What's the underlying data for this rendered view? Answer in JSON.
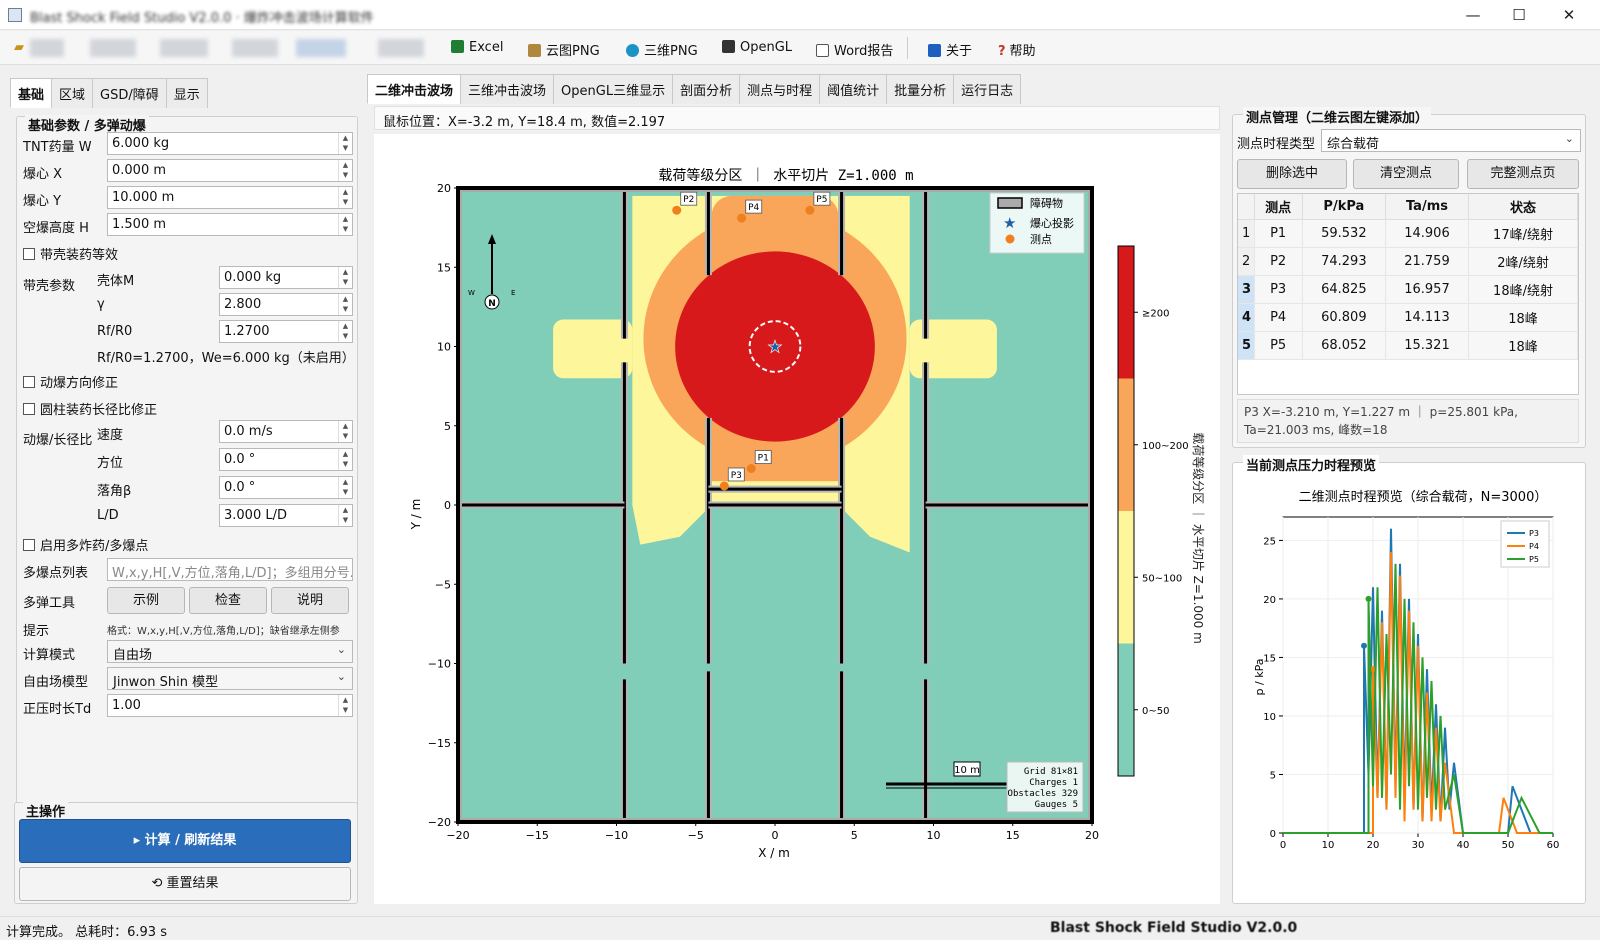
{
  "window": {
    "title": "Blast Shock Field Studio V2.0.0 · 爆炸冲击波场计算软件",
    "min": "—",
    "max": "☐",
    "close": "✕"
  },
  "menubar": [
    {
      "label": "Excel",
      "icon": "excel-icon",
      "color": "#1e7e34"
    },
    {
      "label": "云图PNG",
      "icon": "image-icon",
      "color": "#8a6d3b"
    },
    {
      "label": "三维PNG",
      "icon": "globe-icon",
      "color": "#1a94c4"
    },
    {
      "label": "OpenGL",
      "icon": "opengl-icon",
      "color": "#333333"
    },
    {
      "label": "Word报告",
      "icon": "document-icon",
      "color": "#555555"
    },
    {
      "label": "关于",
      "icon": "info-icon",
      "color": "#1f5fbf"
    },
    {
      "label": "帮助",
      "icon": "help-icon",
      "color": "#c0392b"
    }
  ],
  "left": {
    "tabs": [
      "基础",
      "区域",
      "GSD/障碍",
      "显示"
    ],
    "group_title": "基础参数 / 多弹动爆",
    "tnt": {
      "label": "TNT药量 W",
      "value": "6.000 kg"
    },
    "cx": {
      "label": "爆心 X",
      "value": "0.000 m"
    },
    "cy": {
      "label": "爆心 Y",
      "value": "10.000 m"
    },
    "h": {
      "label": "空爆高度 H",
      "value": "1.500 m"
    },
    "shell_check": "带壳装药等效",
    "shell_label": "带壳参数",
    "shell_mass": {
      "label": "壳体M",
      "value": "0.000 kg"
    },
    "gamma": {
      "label": "γ",
      "value": "2.800"
    },
    "rf": {
      "label": "Rf/R0",
      "value": "1.2700"
    },
    "rf_note": "Rf/R0=1.2700，We=6.000 kg（未启用）",
    "dyn_check": "动爆方向修正",
    "cyl_check": "圆柱装药长径比修正",
    "dyn_label": "动爆/长径比",
    "speed": {
      "label": "速度",
      "value": "0.0 m/s"
    },
    "azimuth": {
      "label": "方位",
      "value": "0.0 °"
    },
    "fall": {
      "label": "落角β",
      "value": "0.0 °"
    },
    "ld": {
      "label": "L/D",
      "value": "3.000 L/D"
    },
    "multi_check": "启用多炸药/多爆点",
    "multi_list": {
      "label": "多爆点列表",
      "placeholder": "W,x,y,H[,V,方位,落角,L/D]；多组用分号..."
    },
    "tools": {
      "label": "多弹工具",
      "buttons": [
        "示例",
        "检查",
        "说明"
      ]
    },
    "hint": {
      "label": "提示",
      "text": "格式：W,x,y,H[,V,方位,落角,L/D]；缺省继承左侧参"
    },
    "mode": {
      "label": "计算模式",
      "value": "自由场"
    },
    "model": {
      "label": "自由场模型",
      "value": "Jinwon Shin 模型"
    },
    "td": {
      "label": "正压时长Td",
      "value": "1.00"
    },
    "main_title": "主操作",
    "compute": "▸  计算 / 刷新结果",
    "reset": "重置结果"
  },
  "center": {
    "tabs": [
      "二维冲击波场",
      "三维冲击波场",
      "OpenGL三维显示",
      "剖面分析",
      "测点与时程",
      "阈值统计",
      "批量分析",
      "运行日志"
    ],
    "mouse": "鼠标位置：X=-3.2 m, Y=18.4 m, 数值=2.197"
  },
  "heatmap": {
    "type": "heatmap",
    "title": "载荷等级分区  ｜  水平切片 Z=1.000 m",
    "xlabel": "X / m",
    "ylabel": "Y / m",
    "xlim": [
      -20,
      20
    ],
    "ylim": [
      -20,
      20
    ],
    "xticks": [
      "−20",
      "−15",
      "−10",
      "−5",
      "0",
      "5",
      "10",
      "15",
      "20"
    ],
    "yticks": [
      "20",
      "15",
      "10",
      "5",
      "0",
      "−5",
      "−10",
      "−15",
      "−20"
    ],
    "colorbar": [
      "≥200",
      "100~200",
      "50~100",
      "0~50"
    ],
    "colorbar_title": "载荷等级分区  ｜  水平切片 Z=1.000 m",
    "colors": {
      "c200": "#d7191c",
      "c100": "#f9a65a",
      "c50": "#fdf69b",
      "c0": "#80cdb8"
    },
    "charge": {
      "x": 0,
      "y": 10
    },
    "legend": [
      "障碍物",
      "爆心投影",
      "测点"
    ],
    "north": {
      "n": "N",
      "w": "W",
      "e": "E"
    },
    "scalebar": "10 m",
    "info": [
      "Grid 81×81",
      "Charges 1",
      "Obstacles 329",
      "Gauges 5"
    ],
    "gauges": [
      {
        "name": "P1",
        "x": -1.5,
        "y": 2.3
      },
      {
        "name": "P2",
        "x": -6.2,
        "y": 18.6
      },
      {
        "name": "P3",
        "x": -3.2,
        "y": 1.2
      },
      {
        "name": "P4",
        "x": -2.1,
        "y": 18.1
      },
      {
        "name": "P5",
        "x": 2.2,
        "y": 18.6
      }
    ]
  },
  "right": {
    "title": "测点管理（二维云图左键添加）",
    "type": {
      "label": "测点时程类型",
      "value": "综合载荷"
    },
    "buttons": [
      "删除选中",
      "清空测点",
      "完整测点页"
    ],
    "columns": [
      "测点",
      "P/kPa",
      "Ta/ms",
      "状态"
    ],
    "rows": [
      {
        "n": "1",
        "name": "P1",
        "p": "59.532",
        "ta": "14.906",
        "status": "17峰/绕射"
      },
      {
        "n": "2",
        "name": "P2",
        "p": "74.293",
        "ta": "21.759",
        "status": "2峰/绕射"
      },
      {
        "n": "3",
        "name": "P3",
        "p": "64.825",
        "ta": "16.957",
        "status": "18峰/绕射"
      },
      {
        "n": "4",
        "name": "P4",
        "p": "60.809",
        "ta": "14.113",
        "status": "18峰"
      },
      {
        "n": "5",
        "name": "P5",
        "p": "68.052",
        "ta": "15.321",
        "status": "18峰"
      }
    ],
    "info1": "P3  X=-3.210 m, Y=1.227 m ｜ p=25.801 kPa,",
    "info2": "Ta=21.003 ms, 峰数=18",
    "preview_title": "当前测点压力时程预览"
  },
  "chart_data": {
    "type": "line",
    "title": "二维测点时程预览（综合载荷，N=3000）",
    "xlabel": "",
    "ylabel": "p / kPa",
    "xlim": [
      0,
      60
    ],
    "ylim": [
      0,
      27
    ],
    "xticks": [
      "0",
      "10",
      "20",
      "30",
      "40",
      "50",
      "60"
    ],
    "yticks": [
      "0",
      "5",
      "10",
      "15",
      "20",
      "25"
    ],
    "series": [
      {
        "name": "P3",
        "color": "#1f77b4",
        "x": [
          0,
          18,
          18,
          19,
          20,
          21,
          22,
          23,
          24,
          25,
          26,
          27,
          28,
          29,
          30,
          31,
          32,
          33,
          34,
          35,
          36,
          37,
          38,
          40,
          42,
          50,
          51,
          55,
          60
        ],
        "y": [
          0,
          0,
          16,
          5,
          21,
          3,
          19,
          2,
          26,
          4,
          23,
          3,
          20,
          2,
          17,
          1,
          14,
          2,
          11,
          1,
          9,
          2,
          6,
          0,
          0,
          0,
          4,
          0,
          0
        ]
      },
      {
        "name": "P4",
        "color": "#ff7f0e",
        "x": [
          0,
          20,
          20,
          21,
          22,
          23,
          24,
          25,
          26,
          27,
          28,
          29,
          30,
          31,
          32,
          33,
          34,
          35,
          36,
          38,
          40,
          48,
          49,
          52,
          60
        ],
        "y": [
          0,
          0,
          14,
          3,
          18,
          2,
          24,
          3,
          22,
          1,
          19,
          2,
          16,
          1,
          12,
          1,
          9,
          1,
          6,
          0,
          0,
          0,
          3,
          0,
          0
        ]
      },
      {
        "name": "P5",
        "color": "#2ca02c",
        "x": [
          0,
          19,
          19,
          20,
          21,
          22,
          23,
          24,
          25,
          26,
          27,
          28,
          29,
          30,
          31,
          32,
          33,
          34,
          35,
          36,
          38,
          40,
          50,
          53,
          57,
          60
        ],
        "y": [
          0,
          0,
          20,
          4,
          21,
          3,
          17,
          5,
          23,
          2,
          20,
          4,
          18,
          2,
          15,
          3,
          13,
          2,
          10,
          2,
          5,
          0,
          0,
          3,
          0,
          0
        ]
      }
    ]
  },
  "status": {
    "left": "计算完成。 总耗时：6.93 s",
    "right": "Blast Shock Field Studio V2.0.0"
  }
}
